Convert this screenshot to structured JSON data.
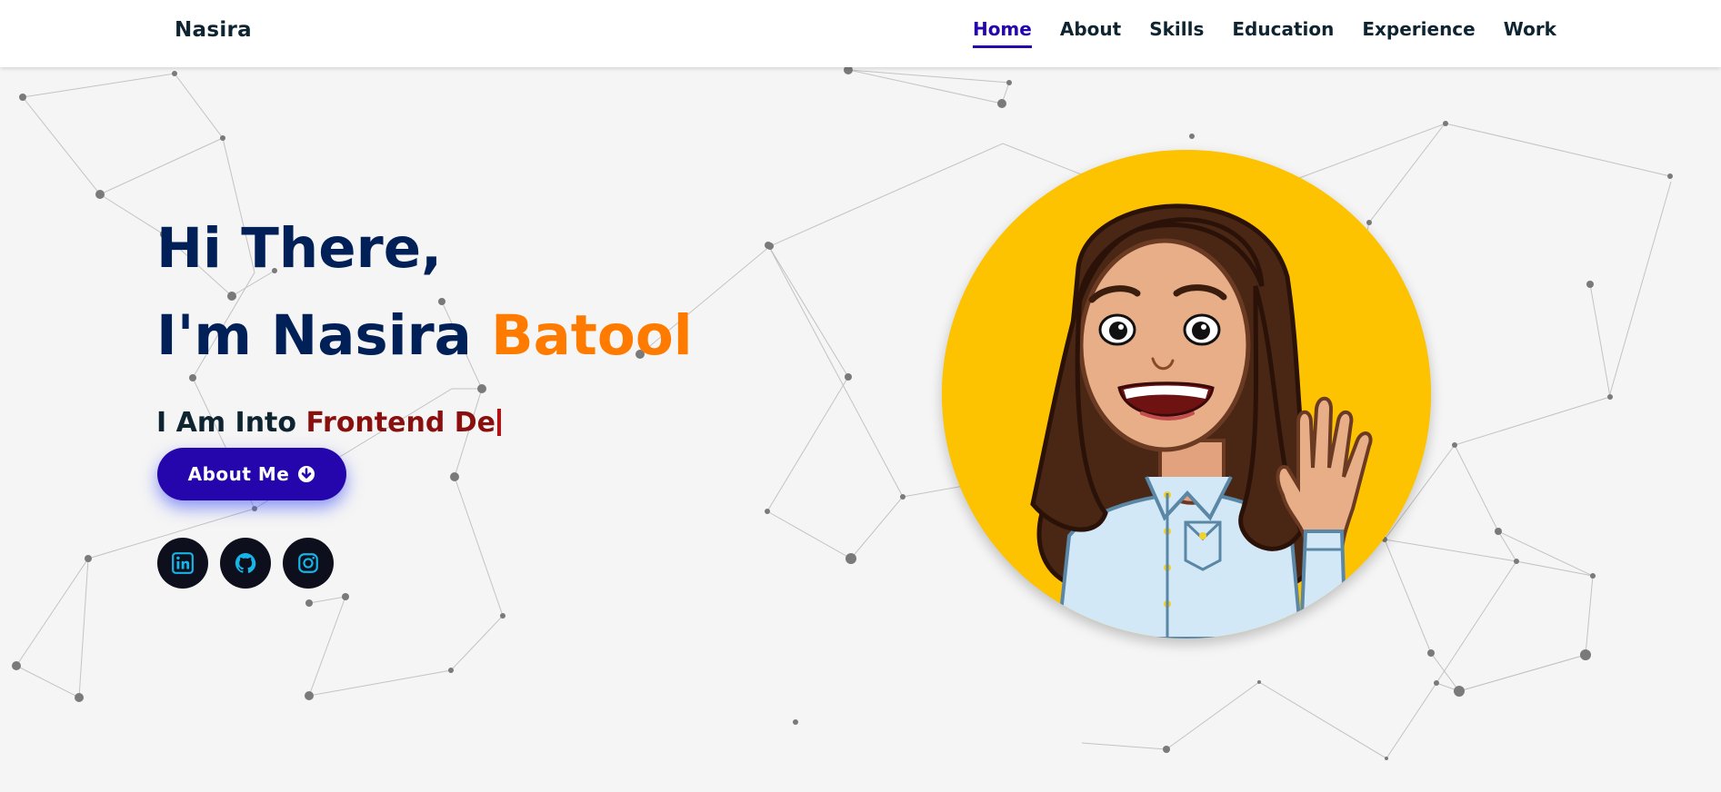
{
  "brand": "Nasira",
  "nav": {
    "items": [
      {
        "label": "Home",
        "active": true
      },
      {
        "label": "About",
        "active": false
      },
      {
        "label": "Skills",
        "active": false
      },
      {
        "label": "Education",
        "active": false
      },
      {
        "label": "Experience",
        "active": false
      },
      {
        "label": "Work",
        "active": false
      }
    ]
  },
  "hero": {
    "greeting": "Hi There,",
    "intro_prefix": "I'm Nasira ",
    "intro_accent": "Batool",
    "typed_prefix": "I Am Into ",
    "typed_text": "Frontend De",
    "button_label": "About Me",
    "button_icon": "arrow-circle-down-icon"
  },
  "socials": [
    {
      "icon": "linkedin-icon",
      "label": "LinkedIn"
    },
    {
      "icon": "github-icon",
      "label": "GitHub"
    },
    {
      "icon": "instagram-icon",
      "label": "Instagram"
    }
  ],
  "avatar": {
    "icon": "waving-girl-avatar"
  },
  "colors": {
    "navy": "#002057",
    "accent_orange": "#ff7b00",
    "typed_red": "#8a0f0f",
    "primary_button": "#2506ad",
    "avatar_bg": "#fdc300",
    "social_icon": "#16b5e8",
    "page_bg": "#f5f5f5"
  }
}
